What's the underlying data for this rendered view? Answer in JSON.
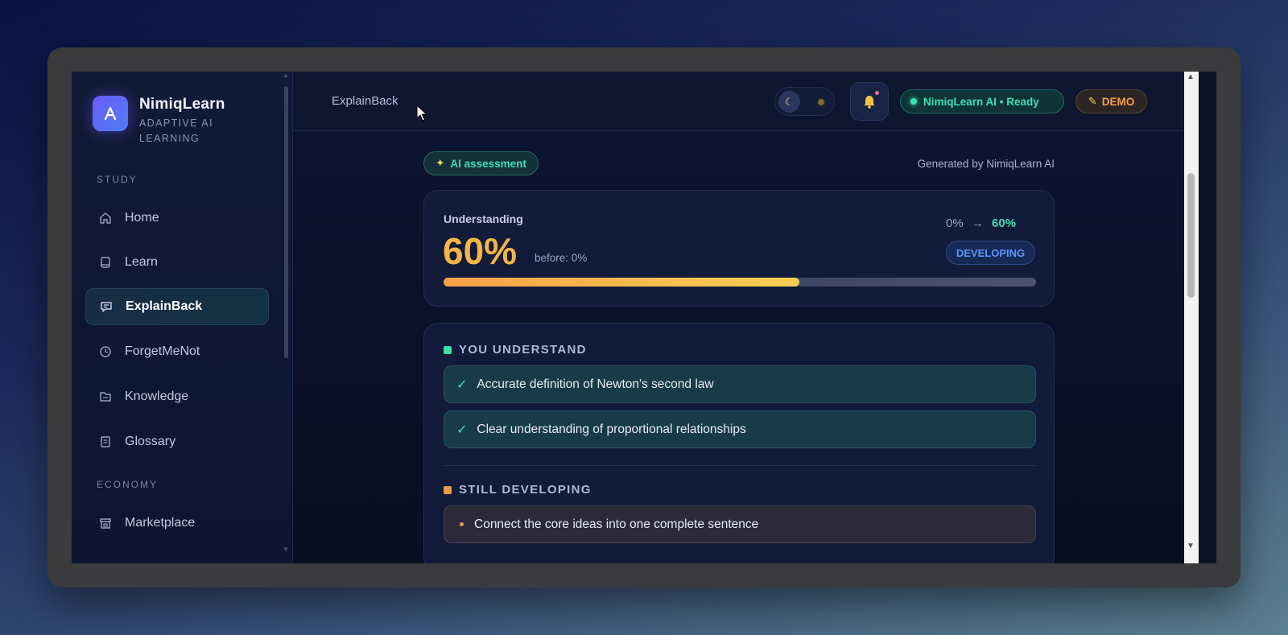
{
  "brand": {
    "name": "NimiqLearn",
    "tagline": "ADAPTIVE AI LEARNING",
    "logo_letter": "A"
  },
  "sidebar": {
    "section_study": "STUDY",
    "section_economy": "ECONOMY",
    "items": [
      {
        "label": "Home",
        "icon": "home-icon"
      },
      {
        "label": "Learn",
        "icon": "book-icon"
      },
      {
        "label": "ExplainBack",
        "icon": "chat-icon",
        "active": true
      },
      {
        "label": "ForgetMeNot",
        "icon": "clock-icon"
      },
      {
        "label": "Knowledge",
        "icon": "folder-icon"
      },
      {
        "label": "Glossary",
        "icon": "document-icon"
      },
      {
        "label": "Marketplace",
        "icon": "store-icon"
      }
    ]
  },
  "topbar": {
    "breadcrumb": "ExplainBack",
    "status": "NimiqLearn AI • Ready",
    "demo_label": "DEMO",
    "demo_icon": "pencil-icon"
  },
  "assessment": {
    "pill_label": "AI assessment",
    "pill_icon": "sparkles-icon",
    "generated_by": "Generated by NimiqLearn AI",
    "understanding_label": "Understanding",
    "value": "60%",
    "before": "before: 0%",
    "from": "0%",
    "arrow": "→",
    "to": "60%",
    "badge": "DEVELOPING",
    "progress": 0.6
  },
  "feedback": {
    "understand_heading": "YOU UNDERSTAND",
    "understand_items": [
      "Accurate definition of Newton's second law",
      "Clear understanding of proportional relationships"
    ],
    "developing_heading": "STILL DEVELOPING",
    "developing_items": [
      "Connect the core ideas into one complete sentence"
    ]
  },
  "colors": {
    "accent_green": "#3ee0b0",
    "accent_orange": "#f4b547",
    "accent_blue": "#5e95f5",
    "bg": "#0b1228"
  }
}
